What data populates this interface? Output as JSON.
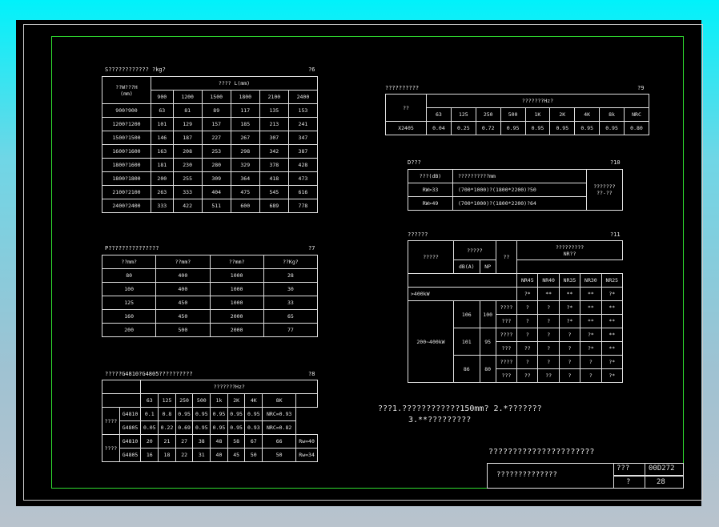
{
  "t6": {
    "title": "S???????????? ?kg?",
    "num": "?6",
    "h_size": "??W???H",
    "h_mm": "(mm)",
    "h_len": "???? L(mm)",
    "cols": [
      "900",
      "1200",
      "1500",
      "1800",
      "2100",
      "2400"
    ],
    "rows": [
      [
        "900?900",
        "63",
        "81",
        "89",
        "117",
        "135",
        "153"
      ],
      [
        "1200?1200",
        "101",
        "129",
        "157",
        "185",
        "213",
        "241"
      ],
      [
        "1500?1500",
        "146",
        "187",
        "227",
        "267",
        "307",
        "347"
      ],
      [
        "1600?1600",
        "163",
        "208",
        "253",
        "298",
        "342",
        "387"
      ],
      [
        "1800?1600",
        "181",
        "230",
        "280",
        "329",
        "378",
        "428"
      ],
      [
        "1800?1800",
        "200",
        "255",
        "309",
        "364",
        "418",
        "473"
      ],
      [
        "2100?2100",
        "263",
        "333",
        "404",
        "475",
        "545",
        "616"
      ],
      [
        "2400?2400",
        "333",
        "422",
        "511",
        "600",
        "689",
        "778"
      ]
    ]
  },
  "t7": {
    "title": "P???????????????",
    "num": "?7",
    "head": [
      "??mm?",
      "??mm?",
      "??mm?",
      "??Kg?"
    ],
    "rows": [
      [
        "80",
        "400",
        "1000",
        "28"
      ],
      [
        "100",
        "400",
        "1000",
        "30"
      ],
      [
        "125",
        "450",
        "1000",
        "33"
      ],
      [
        "160",
        "450",
        "2000",
        "65"
      ],
      [
        "200",
        "500",
        "2000",
        "77"
      ]
    ]
  },
  "t8": {
    "title": "?????G4810?G4805??????????",
    "num": "?8",
    "freq": "???????Hz?",
    "cols": [
      "63",
      "125",
      "250",
      "500",
      "1k",
      "2K",
      "4K",
      "8K"
    ],
    "g1": "????",
    "g2": "????",
    "rows": [
      [
        "G4810",
        "0.1",
        "0.8",
        "0.95",
        "0.95",
        "0.95",
        "0.95",
        "0.95",
        "NRC=0.93"
      ],
      [
        "G4805",
        "0.05",
        "0.22",
        "0.69",
        "0.95",
        "0.95",
        "0.95",
        "0.93",
        "NRC=0.82"
      ],
      [
        "G4810",
        "20",
        "21",
        "27",
        "38",
        "48",
        "58",
        "67",
        "66",
        "Rw=40"
      ],
      [
        "G4805",
        "16",
        "18",
        "22",
        "31",
        "40",
        "45",
        "50",
        "50",
        "Rw=34"
      ]
    ]
  },
  "t9": {
    "title": "??????????",
    "num": "?9",
    "c0": "??",
    "freq": "???????Hz?",
    "cols": [
      "63",
      "125",
      "250",
      "500",
      "1K",
      "2K",
      "4K",
      "8k",
      "NRC"
    ],
    "row": [
      "X2405",
      "0.04",
      "0.25",
      "0.72",
      "0.95",
      "0.95",
      "0.95",
      "0.95",
      "0.95",
      "0.80"
    ]
  },
  "t10": {
    "title": "D???",
    "num": "?10",
    "h1": "???(dB)",
    "h2": "??????????mm",
    "note1": "???????",
    "note2": "??-??",
    "rows": [
      [
        "RW>33",
        "(700*1000)?(1800*2200)?50"
      ],
      [
        "RW>49",
        "(700*1000)?(1800*2200)?64"
      ]
    ]
  },
  "t11": {
    "title": "??????",
    "num": "?11",
    "c_power": "?????",
    "c_level": "?????",
    "c_db": "dB(A)",
    "c_np": "NP",
    "c_pos": "??",
    "c_nr": "?????????",
    "c_nr2": "NR??",
    "nrs": [
      "NR45",
      "NR40",
      "NR35",
      "NR30",
      "NR25"
    ],
    "row_big": ">400kW",
    "row_big_v": [
      "?*",
      "**",
      "**",
      "**",
      "?*"
    ],
    "range": "200~400kW",
    "sub": [
      {
        "db": "106",
        "np": "100",
        "r": [
          [
            "????",
            "?",
            "?",
            "?*",
            "**",
            "**"
          ],
          [
            "???",
            "?",
            "?",
            "?*",
            "**",
            "**"
          ]
        ]
      },
      {
        "db": "101",
        "np": "95",
        "r": [
          [
            "????",
            "?",
            "?",
            "?",
            "?*",
            "**"
          ],
          [
            "???",
            "??",
            "?",
            "?",
            "?*",
            "**"
          ]
        ]
      },
      {
        "db": "86",
        "np": "80",
        "r": [
          [
            "????",
            "?",
            "?",
            "?",
            "?",
            "?*"
          ],
          [
            "???",
            "??",
            "??",
            "?",
            "?",
            "?*"
          ]
        ]
      }
    ]
  },
  "notes": {
    "l1": "???1.????????????150mm?  2.*???????",
    "l2": "3.**?????????"
  },
  "title_block": {
    "main": "??????????????????????",
    "name": "??????????????",
    "k1": "???",
    "v1": "00D272",
    "k2": "?",
    "v2": "28"
  }
}
